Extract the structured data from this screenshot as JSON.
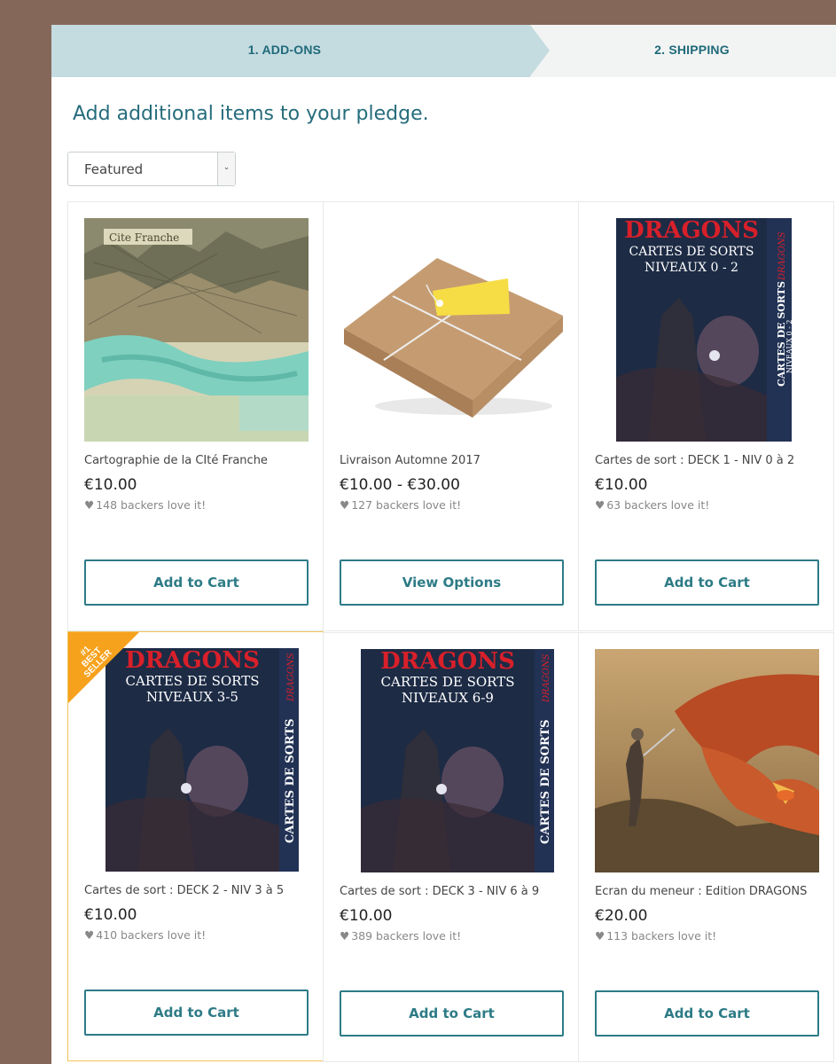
{
  "steps": [
    {
      "label": "1. ADD-ONS",
      "active": true
    },
    {
      "label": "2. SHIPPING",
      "active": false
    }
  ],
  "heading": "Add additional items to your pledge.",
  "sort": {
    "selected": "Featured"
  },
  "products": [
    {
      "title": "Cartographie de la CIté Franche",
      "price": "€10.00",
      "love": "148 backers love it!",
      "button": "Add to Cart",
      "image": "city-map"
    },
    {
      "title": "Livraison Automne 2017",
      "price": "€10.00 - €30.00",
      "love": "127 backers love it!",
      "button": "View Options",
      "image": "parcel"
    },
    {
      "title": "Cartes de sort : DECK 1 - NIV 0 à 2",
      "price": "€10.00",
      "love": "63 backers love it!",
      "button": "Add to Cart",
      "image": "spell-deck",
      "deck": {
        "brand": "DRAGONS",
        "line1": "CARTES DE SORTS",
        "line2": "NIVEAUX 0 - 2",
        "side": "CARTES DE SORTS",
        "side2": "NIVEAUX 0 - 2"
      }
    },
    {
      "title": "Cartes de sort : DECK 2 - NIV 3 à 5",
      "price": "€10.00",
      "love": "410 backers love it!",
      "button": "Add to Cart",
      "image": "spell-deck",
      "badge": "#1 BEST SELLER",
      "deck": {
        "brand": "DRAGONS",
        "line1": "CARTES DE SORTS",
        "line2": "NIVEAUX 3-5",
        "side": "CARTES DE SORTS",
        "side_brand": "DRAGONS"
      }
    },
    {
      "title": "Cartes de sort : DECK 3 - NIV 6 à 9",
      "price": "€10.00",
      "love": "389 backers love it!",
      "button": "Add to Cart",
      "image": "spell-deck",
      "deck": {
        "brand": "DRAGONS",
        "line1": "CARTES DE SORTS",
        "line2": "NIVEAUX 6-9",
        "side": "CARTES DE SORTS",
        "side_brand": "DRAGONS"
      }
    },
    {
      "title": "Ecran du meneur : Edition DRAGONS",
      "price": "€20.00",
      "love": "113 backers love it!",
      "button": "Add to Cart",
      "image": "dragon-art"
    }
  ],
  "map_label": "Cite Franche",
  "colors": {
    "accent": "#2d7b86",
    "badge": "#f6a21d",
    "step_active": "#c4dbe0",
    "page_bg": "#85675a"
  }
}
